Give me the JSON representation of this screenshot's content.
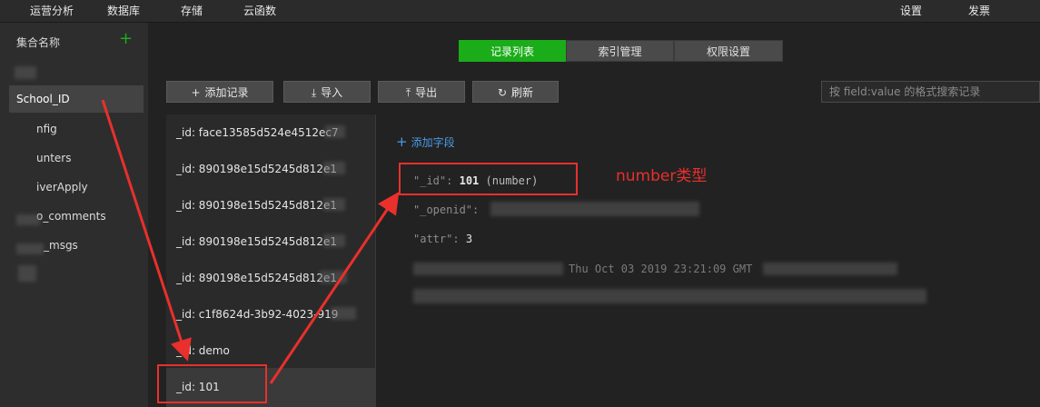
{
  "topnav": {
    "items": [
      "运营分析",
      "数据库",
      "存储",
      "云函数"
    ],
    "right": [
      "设置",
      "发票"
    ]
  },
  "sidebar": {
    "header": "集合名称",
    "collections": [
      "School_ID",
      "nfig",
      "unters",
      "iverApply",
      "o_comments",
      "_msgs"
    ]
  },
  "tabs": [
    "记录列表",
    "索引管理",
    "权限设置"
  ],
  "toolbar": {
    "add_label": "添加记录",
    "import_label": "导入",
    "export_label": "导出",
    "refresh_label": "刷新"
  },
  "search": {
    "placeholder": "按 field:value 的格式搜索记录"
  },
  "records": [
    "_id: face13585d524e4512ec7",
    "_id: 890198e15d5245d812e1",
    "_id: 890198e15d5245d812e1",
    "_id: 890198e15d5245d812e1",
    "_id: 890198e15d5245d812e1",
    "_id: c1f8624d-3b92-4023-919",
    "_id: demo",
    "_id: 101"
  ],
  "detail": {
    "add_field": "添加字段",
    "id_key": "\"_id\":",
    "id_value": "101",
    "id_type": "(number)",
    "openid_key": "\"_openid\":",
    "attr_key": "\"attr\":",
    "attr_value": "3",
    "date_partial": "Thu Oct 03 2019 23:21:09 GMT"
  },
  "annotation": {
    "note": "number类型",
    "color": "#e8302c"
  },
  "colors": {
    "accent": "#1aad19",
    "link": "#4a9be6"
  }
}
